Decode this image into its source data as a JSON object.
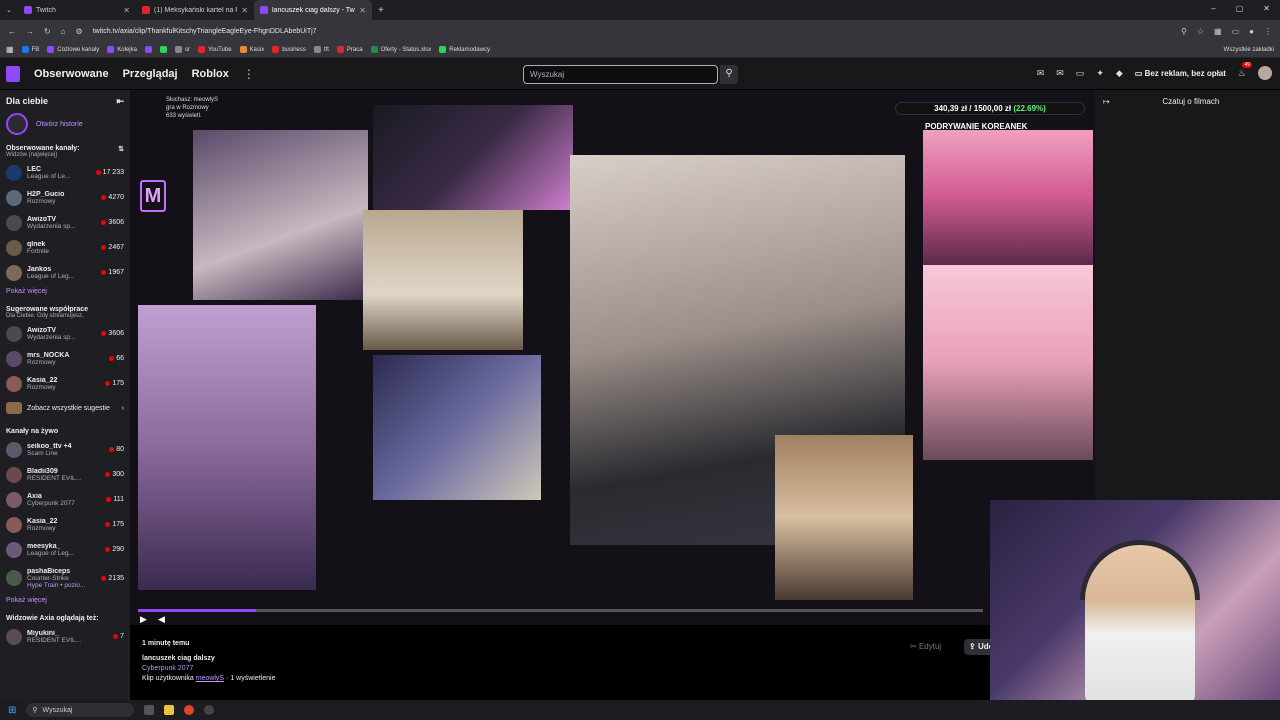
{
  "browser": {
    "tabs": [
      {
        "label": "Twitch",
        "kind": "twitch",
        "active": false
      },
      {
        "label": "(1) Meksykański kartel na Podla",
        "kind": "yt",
        "active": false
      },
      {
        "label": "lancuszek ciag dalszy - Twitch",
        "kind": "twitch",
        "active": true
      }
    ],
    "new_tab": "+",
    "url": "twitch.tv/axia/clip/ThankfulKitschyTriangleEagleEye-FhgnDDLAbebUiTj7",
    "window_controls": [
      "–",
      "▢",
      "✕"
    ],
    "bookmarks": [
      {
        "label": "FB",
        "color": "#1877f2"
      },
      {
        "label": "Cozlowe kanaly",
        "color": "#9146ff"
      },
      {
        "label": "Kolejka",
        "color": "#9146ff"
      },
      {
        "label": "",
        "color": "#9146ff"
      },
      {
        "label": "",
        "color": "#2bd65a"
      },
      {
        "label": "sr",
        "color": "#888888"
      },
      {
        "label": "YouTube",
        "color": "#e0262a"
      },
      {
        "label": "Kasix",
        "color": "#e88a2a"
      },
      {
        "label": "business",
        "color": "#e0262a"
      },
      {
        "label": "tft",
        "color": "#888888"
      },
      {
        "label": "Praca",
        "color": "#e0262a"
      },
      {
        "label": "Oferty - Status.xlsx",
        "color": "#1d8f4a"
      },
      {
        "label": "Reklamodawcy",
        "color": "#2bd65a"
      }
    ],
    "bookmarks_right": "Wszystkie zakładki"
  },
  "nav": {
    "links": [
      "Obserwowane",
      "Przeglądaj",
      "Roblox"
    ],
    "more": "⋮",
    "search_placeholder": "Wyszukaj",
    "no_ads": "Bez reklam, bez opłat",
    "notifications": "49"
  },
  "sidebar": {
    "title": "Dla ciebie",
    "history": "Otwórz historie",
    "followed_title": "Obserwowane kanały:",
    "followed_sub": "Widzów (najwięcej)",
    "followed": [
      {
        "name": "LEC",
        "game": "League of Le...",
        "viewers": "17 233",
        "color": "#1a3a6a"
      },
      {
        "name": "H2P_Gucio",
        "game": "Rozmowy",
        "viewers": "4270",
        "color": "#5a6a7a"
      },
      {
        "name": "AwizoTV",
        "game": "Wydarzenia sp...",
        "viewers": "3606",
        "color": "#4a4a4a"
      },
      {
        "name": "qlnek",
        "game": "Fortnite",
        "viewers": "2467",
        "color": "#6a5a4a"
      },
      {
        "name": "Jankos",
        "game": "League of Leg...",
        "viewers": "1967",
        "color": "#7a6a5a"
      }
    ],
    "show_more": "Pokaż więcej",
    "suggested_title": "Sugerowane współprace",
    "suggested_sub": "Dla Ciebie. Gdy streamujesz.",
    "suggested": [
      {
        "name": "AwizoTV",
        "game": "Wydarzenia sp...",
        "viewers": "3606",
        "color": "#4a4a4a"
      },
      {
        "name": "mrs_NOCKA",
        "game": "Rozmowy",
        "viewers": "66",
        "color": "#5a4a6a"
      },
      {
        "name": "Kasia_22",
        "game": "Rozmowy",
        "viewers": "175",
        "color": "#8a5a5a"
      }
    ],
    "see_all": "Zobacz wszystkie sugestie",
    "live_title": "Kanały na żywo",
    "live": [
      {
        "name": "seikoo_ttv +4",
        "game": "Scam Line",
        "viewers": "80",
        "color": "#5a5a6a"
      },
      {
        "name": "Bladii309",
        "game": "RESIDENT EVIL...",
        "viewers": "300",
        "color": "#6a4a4a"
      },
      {
        "name": "Axia",
        "game": "Cyberpunk 2077",
        "viewers": "111",
        "color": "#7a5a6a"
      },
      {
        "name": "Kasia_22",
        "game": "Rozmowy",
        "viewers": "175",
        "color": "#8a5a5a"
      },
      {
        "name": "meesyka_",
        "game": "League of Leg...",
        "viewers": "290",
        "color": "#6a5a7a"
      },
      {
        "name": "pashaBiceps",
        "game": "Counter-Strike",
        "viewers": "2135",
        "color": "#4a5a4a",
        "extra": "Hype Train • pozio..."
      }
    ],
    "show_more2": "Pokaż więcej",
    "also_title": "Widzowie Axia oglądają też:",
    "also": [
      {
        "name": "Miyukini_",
        "game": "RESIDENT EVIL...",
        "viewers": "7",
        "color": "#5a4a5a"
      }
    ]
  },
  "player": {
    "donation_amount": "340,39 zł",
    "donation_goal": "1500,00 zł",
    "donation_pct": "(22.69%)",
    "overlay_title": "PODRYWANIE KOREANEK",
    "clip_overlay_lines": [
      "Słuchasz: meowlyS",
      "gra w Rozmowy",
      "633 wyświetl."
    ],
    "progress": 0.14,
    "play_icon": "▶",
    "volume_icon": "◀",
    "fullscreen_icon": "⛶"
  },
  "clip": {
    "time": "1 minutę temu",
    "title": "lancuszek ciag dalszy",
    "game": "Cyberpunk 2077",
    "by_prefix": "Klip użytkownika",
    "author": "meowlyS",
    "views": " · 1 wyświetlenie",
    "edit": "Edytuj",
    "share": "Udo"
  },
  "chat": {
    "title": "Czatuj o filmach"
  },
  "taskbar": {
    "search": "Wyszukaj"
  },
  "colors": {
    "twitch_purple": "#9146ff",
    "live_red": "#eb0400",
    "link_purple": "#bf94ff"
  }
}
